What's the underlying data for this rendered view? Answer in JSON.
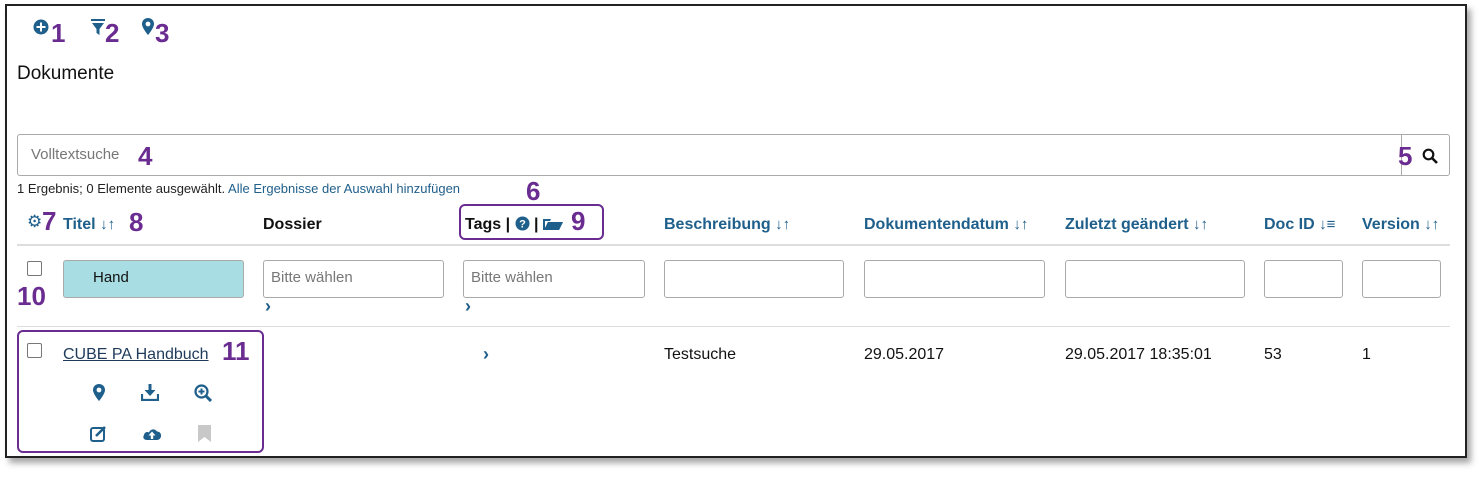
{
  "toolbar": {
    "add_icon": "plus-circle-icon",
    "filter_icon": "filter-icon",
    "pin_icon": "map-marker-icon",
    "callouts": [
      "1",
      "2",
      "3"
    ]
  },
  "page": {
    "title": "Dokumente"
  },
  "search": {
    "placeholder": "Volltextsuche",
    "callout": "4",
    "button_callout": "5"
  },
  "results": {
    "summary": "1 Ergebnis; 0 Elemente ausgewählt.",
    "add_all_link": "Alle Ergebnisse der Auswahl hinzufügen",
    "callout": "6"
  },
  "table": {
    "settings_callout": "7",
    "title_callout": "8",
    "tags_callout": "9",
    "checkbox_callout": "10",
    "row_callout": "11",
    "columns": {
      "titel": "Titel",
      "dossier": "Dossier",
      "tags": "Tags",
      "beschreibung": "Beschreibung",
      "dokumentendatum": "Dokumentendatum",
      "zuletzt": "Zuletzt geändert",
      "docid": "Doc ID",
      "version": "Version"
    },
    "filters": {
      "titel": "Hand",
      "dossier_placeholder": "Bitte wählen",
      "tags_placeholder": "Bitte wählen",
      "beschreibung": "",
      "dokumentendatum": "",
      "zuletzt": "",
      "docid": "",
      "version": ""
    },
    "rows": [
      {
        "titel": "CUBE PA Handbuch",
        "dossier": "",
        "beschreibung": "Testsuche",
        "dokumentendatum": "29.05.2017",
        "zuletzt": "29.05.2017 18:35:01",
        "docid": "53",
        "version": "1"
      }
    ]
  },
  "colors": {
    "accent": "#1f5f8b",
    "callout": "#6a2c91",
    "highlight_filter": "#a8dde3"
  }
}
